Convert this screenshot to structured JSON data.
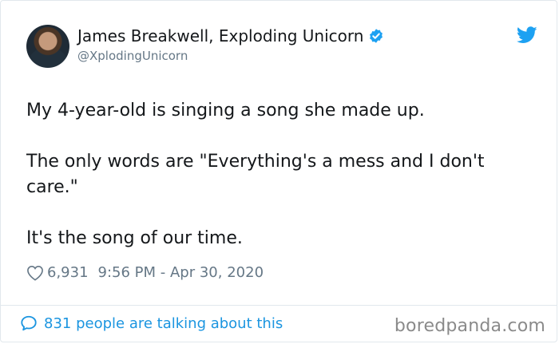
{
  "author": {
    "display_name": "James Breakwell, Exploding Unicorn",
    "handle": "@XplodingUnicorn",
    "verified": true
  },
  "tweet": {
    "paragraphs": [
      "My 4-year-old is singing a song she made up.",
      "The only words are \"Everything's a mess and I don't care.\"",
      "It's the song of our time."
    ],
    "likes": "6,931",
    "timestamp": "9:56 PM - Apr 30, 2020"
  },
  "footer": {
    "conversation_link": "831 people are talking about this",
    "watermark": "boredpanda.com"
  },
  "colors": {
    "text": "#14171a",
    "secondary": "#657786",
    "link": "#1b95e0",
    "verified": "#1da1f2",
    "twitter_brand": "#1da1f2"
  },
  "icons": [
    "verified-badge-icon",
    "twitter-bird-icon",
    "heart-icon",
    "speech-bubble-icon"
  ]
}
